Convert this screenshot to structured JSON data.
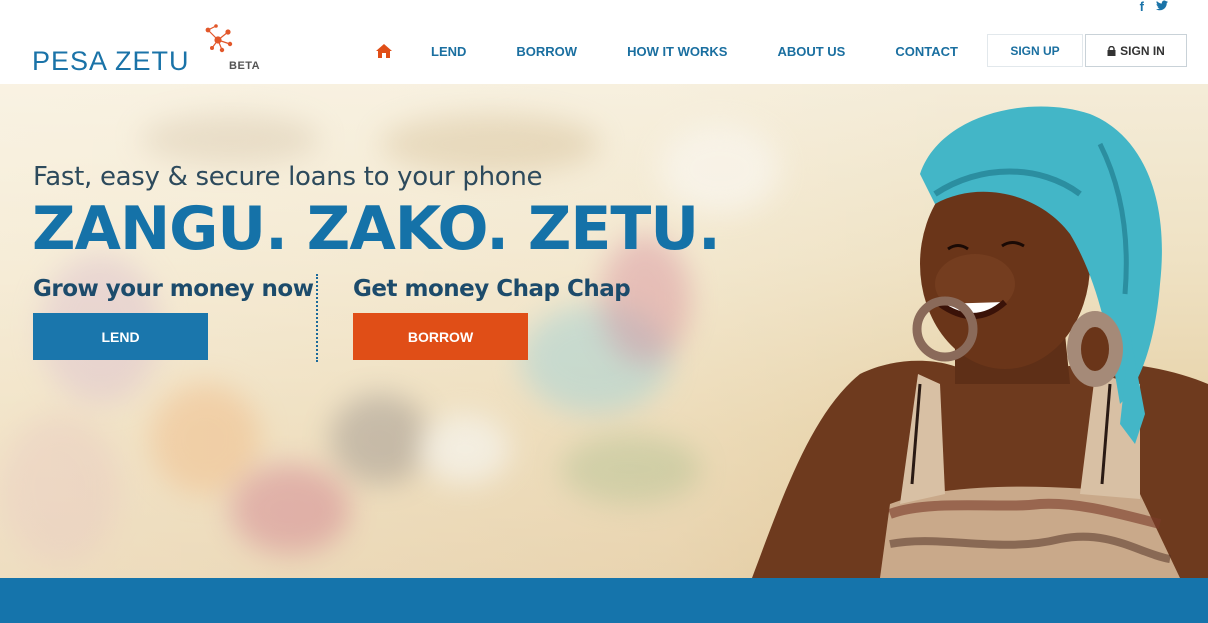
{
  "brand": {
    "name": "PESA ZETU",
    "badge": "BETA"
  },
  "social": {
    "facebook": "f",
    "twitter": "t"
  },
  "nav": {
    "items": [
      "LEND",
      "BORROW",
      "HOW IT WORKS",
      "ABOUT US",
      "CONTACT"
    ],
    "signup": "SIGN UP",
    "signin": "SIGN IN"
  },
  "hero": {
    "tagline": "Fast, easy & secure loans to your phone",
    "headline": "ZANGU. ZAKO. ZETU.",
    "lend_title": "Grow your money now",
    "lend_button": "LEND",
    "borrow_title": "Get money Chap Chap",
    "borrow_button": "BORROW"
  },
  "colors": {
    "primary": "#1a76ac",
    "accent": "#e04e17",
    "heading": "#1c4b6b"
  },
  "icons": {
    "home": "home-icon",
    "lock": "lock-icon",
    "facebook": "facebook-icon",
    "twitter": "twitter-icon"
  }
}
